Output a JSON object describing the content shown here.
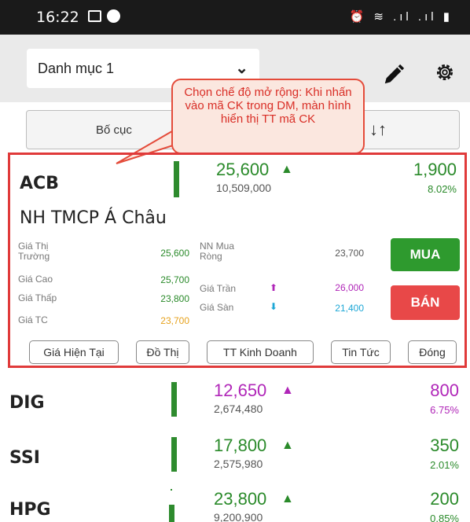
{
  "status_bar": {
    "time": "16:22",
    "right_icons": "⏰ ≋ .ıl .ıl ▮"
  },
  "header": {
    "watchlist": "Danh mục 1",
    "chevron": "⌄"
  },
  "toolbar": {
    "layout_label": "Bố cục",
    "sort_icon": "↓↑"
  },
  "callout": {
    "text": "Chọn chế độ mở rộng: Khi nhấn vào mã CK trong DM, màn hình hiển thị TT  mã CK"
  },
  "expanded": {
    "symbol": "ACB",
    "price": "25,600",
    "volume": "10,509,000",
    "change": "1,900",
    "percent": "8.02%",
    "company": "NH TMCP Á Châu",
    "market_price_label": "Giá Thị Trường",
    "market_price": "25,600",
    "foreign_net_label": "NN Mua Ròng",
    "foreign_net": "23,700",
    "high_label": "Giá Cao",
    "high": "25,700",
    "ceiling_label": "Giá Trần",
    "ceiling": "26,000",
    "low_label": "Giá Thấp",
    "low": "23,800",
    "floor_label": "Giá Sàn",
    "floor": "21,400",
    "ref_label": "Giá TC",
    "ref": "23,700",
    "buy": "MUA",
    "sell": "BÁN",
    "tabs": [
      "Giá Hiện Tại",
      "Đồ Thị",
      "TT Kinh Doanh",
      "Tin Tức",
      "Đóng"
    ]
  },
  "rows": [
    {
      "symbol": "DIG",
      "price": "12,650",
      "volume": "2,674,480",
      "change": "800",
      "percent": "6.75%",
      "color": "#b026b8"
    },
    {
      "symbol": "SSI",
      "price": "17,800",
      "volume": "2,575,980",
      "change": "350",
      "percent": "2.01%",
      "color": "#2a8a2a"
    },
    {
      "symbol": "HPG",
      "price": "23,800",
      "volume": "9,200,900",
      "change": "200",
      "percent": "0.85%",
      "color": "#2a8a2a"
    }
  ]
}
